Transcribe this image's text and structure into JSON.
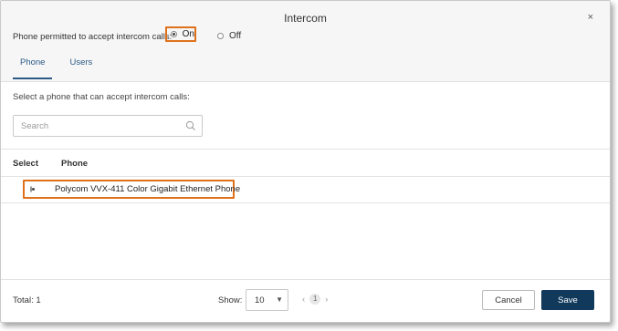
{
  "dialog": {
    "title": "Intercom",
    "close_glyph": "×"
  },
  "permission": {
    "label": "Phone permitted to accept intercom calls:",
    "options": [
      {
        "label": "On",
        "selected": true
      },
      {
        "label": "Off",
        "selected": false
      }
    ]
  },
  "tabs": [
    {
      "label": "Phone",
      "active": true
    },
    {
      "label": "Users",
      "active": false
    }
  ],
  "body": {
    "instruction": "Select a phone that can accept intercom calls:",
    "search_placeholder": "Search"
  },
  "table": {
    "columns": [
      "Select",
      "Phone"
    ],
    "rows": [
      {
        "phone": "Polycom VVX-411 Color Gigabit Ethernet Phone",
        "selected": true
      }
    ]
  },
  "footer": {
    "total_text": "Total: 1",
    "show_label": "Show:",
    "page_size": "10",
    "page_size_caret": "▼",
    "pager": {
      "prev": "‹",
      "current": "1",
      "next": "›"
    },
    "cancel_label": "Cancel",
    "save_label": "Save"
  },
  "colors": {
    "highlight": "#e0711b",
    "primary": "#10395c",
    "tab_text": "#2b5a86"
  },
  "icons": {
    "search": "search-icon",
    "close": "close-icon",
    "caret": "chevron-down-icon"
  }
}
